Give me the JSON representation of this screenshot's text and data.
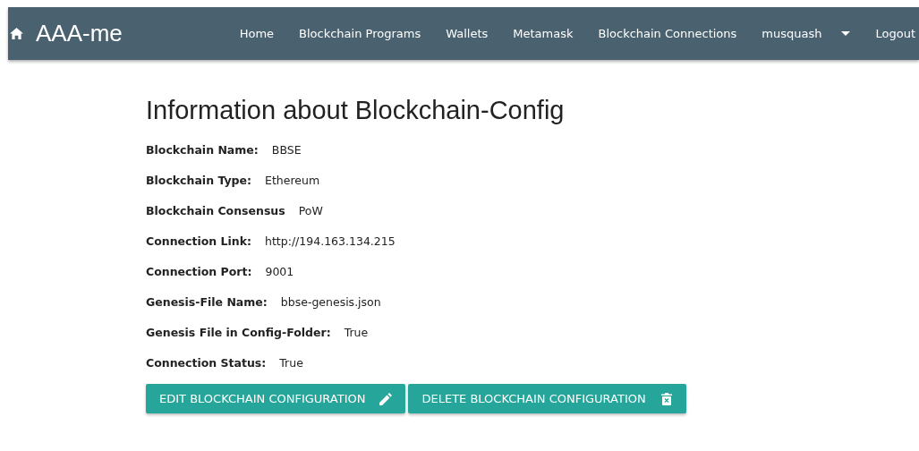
{
  "navbar": {
    "brand": "AAA-me",
    "links": [
      "Home",
      "Blockchain Programs",
      "Wallets",
      "Metamask",
      "Blockchain Connections"
    ],
    "user_menu": "musquash",
    "logout": "Logout"
  },
  "heading": "Information about Blockchain-Config",
  "fields": [
    {
      "label": "Blockchain Name:",
      "value": "BBSE"
    },
    {
      "label": "Blockchain Type:",
      "value": "Ethereum"
    },
    {
      "label": "Blockchain Consensus",
      "value": "PoW"
    },
    {
      "label": "Connection Link:",
      "value": "http://194.163.134.215"
    },
    {
      "label": "Connection Port:",
      "value": "9001"
    },
    {
      "label": "Genesis-File Name:",
      "value": "bbse-genesis.json"
    },
    {
      "label": "Genesis File in Config-Folder:",
      "value": "True"
    },
    {
      "label": "Connection Status:",
      "value": "True"
    }
  ],
  "buttons": [
    {
      "label": "EDIT BLOCKCHAIN CONFIGURATION",
      "kind": "edit"
    },
    {
      "label": "DELETE BLOCKCHAIN CONFIGURATION",
      "kind": "delete"
    }
  ]
}
